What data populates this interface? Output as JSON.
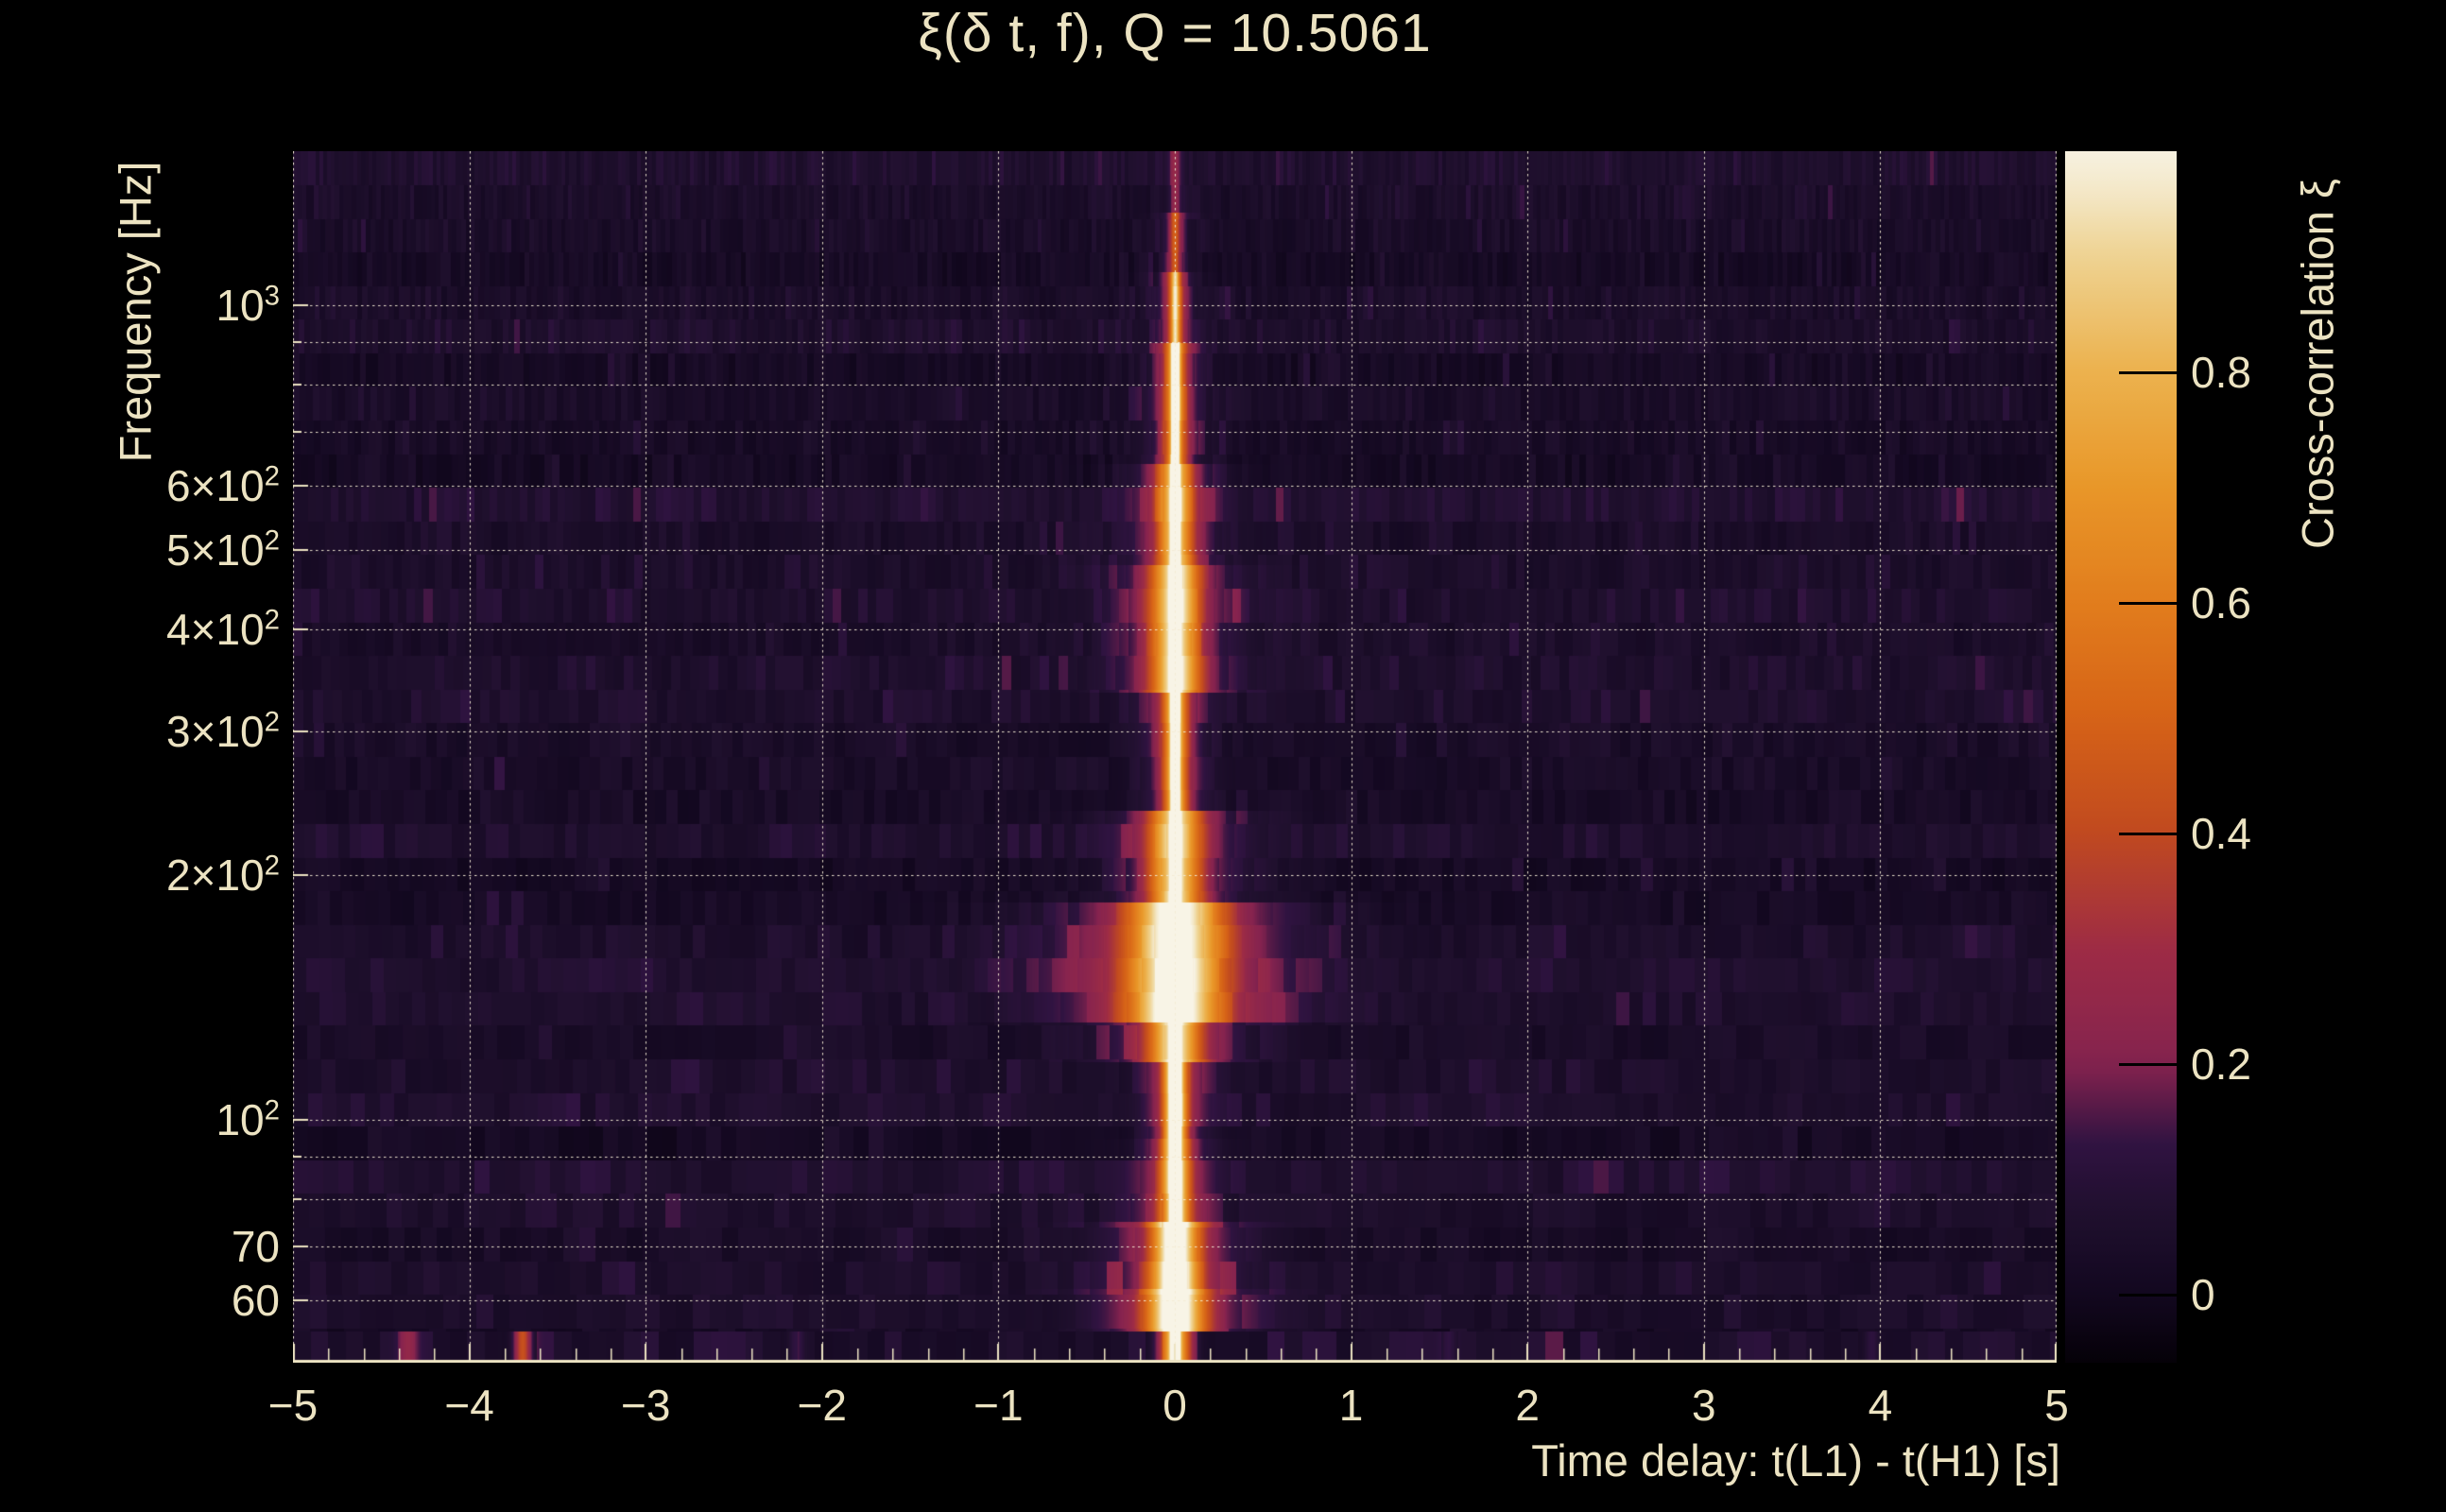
{
  "chart_data": {
    "type": "heatmap",
    "title": "ξ(δ t, f), Q = 10.5061",
    "xlabel": "Time delay: t(L1) - t(H1) [s]",
    "ylabel": "Frequency [Hz]",
    "colorbar_label": "Cross-correlation ξ",
    "background_color": "#000000",
    "text_color": "#ece3c2",
    "grid_color": "#f0e7ca",
    "x_range": [
      -5,
      5
    ],
    "x_major_ticks": [
      {
        "v": -5,
        "label": "−5"
      },
      {
        "v": -4,
        "label": "−4"
      },
      {
        "v": -3,
        "label": "−3"
      },
      {
        "v": -2,
        "label": "−2"
      },
      {
        "v": -1,
        "label": "−1"
      },
      {
        "v": 0,
        "label": "0"
      },
      {
        "v": 1,
        "label": "1"
      },
      {
        "v": 2,
        "label": "2"
      },
      {
        "v": 3,
        "label": "3"
      },
      {
        "v": 4,
        "label": "4"
      },
      {
        "v": 5,
        "label": "5"
      }
    ],
    "x_minor_tick_step": 0.2,
    "y_scale": "log",
    "y_range_hz": [
      50.5,
      1546
    ],
    "y_gridline_freqs_hz": [
      60,
      70,
      80,
      90,
      100,
      200,
      300,
      400,
      500,
      600,
      700,
      800,
      900,
      1000
    ],
    "y_tick_labels": [
      {
        "f": 1000,
        "text": "10",
        "sup": "3"
      },
      {
        "f": 600,
        "text": "6×10",
        "sup": "2"
      },
      {
        "f": 500,
        "text": "5×10",
        "sup": "2"
      },
      {
        "f": 400,
        "text": "4×10",
        "sup": "2"
      },
      {
        "f": 300,
        "text": "3×10",
        "sup": "2"
      },
      {
        "f": 200,
        "text": "2×10",
        "sup": "2"
      },
      {
        "f": 100,
        "text": "10",
        "sup": "2"
      },
      {
        "f": 70,
        "text": "70"
      },
      {
        "f": 60,
        "text": "60"
      }
    ],
    "colorbar": {
      "range": [
        -0.059,
        0.992
      ],
      "ticks": [
        {
          "v": 0.8,
          "label": "0.8"
        },
        {
          "v": 0.6,
          "label": "0.6"
        },
        {
          "v": 0.4,
          "label": "0.4"
        },
        {
          "v": 0.2,
          "label": "0.2"
        },
        {
          "v": 0.0,
          "label": "0"
        }
      ],
      "colormap_stops": [
        {
          "v": -0.06,
          "color": "#050108"
        },
        {
          "v": 0.0,
          "color": "#130820"
        },
        {
          "v": 0.07,
          "color": "#20102e"
        },
        {
          "v": 0.13,
          "color": "#301341"
        },
        {
          "v": 0.2,
          "color": "#85234f"
        },
        {
          "v": 0.3,
          "color": "#9e2c45"
        },
        {
          "v": 0.4,
          "color": "#c14a20"
        },
        {
          "v": 0.5,
          "color": "#d66317"
        },
        {
          "v": 0.6,
          "color": "#e27d1d"
        },
        {
          "v": 0.7,
          "color": "#e99729"
        },
        {
          "v": 0.8,
          "color": "#ecb24e"
        },
        {
          "v": 0.9,
          "color": "#efd391"
        },
        {
          "v": 0.96,
          "color": "#f4e9cb"
        },
        {
          "v": 1.0,
          "color": "#f8f4e6"
        }
      ]
    },
    "signal": {
      "ridge_delay_s": 0,
      "core_width_s": 0.016,
      "bands": [
        {
          "f_lo": 55,
          "f_hi": 62,
          "amp": 0.95,
          "half_width_s": 0.11,
          "core_amp": 1.0
        },
        {
          "f_lo": 62,
          "f_hi": 75,
          "amp": 0.95,
          "half_width_s": 0.09,
          "core_amp": 1.0
        },
        {
          "f_lo": 75,
          "f_hi": 95,
          "amp": 0.82,
          "half_width_s": 0.055,
          "core_amp": 1.0
        },
        {
          "f_lo": 95,
          "f_hi": 118,
          "amp": 0.9,
          "half_width_s": 0.045,
          "core_amp": 1.0
        },
        {
          "f_lo": 118,
          "f_hi": 132,
          "amp": 0.78,
          "half_width_s": 0.1,
          "core_amp": 0.9
        },
        {
          "f_lo": 132,
          "f_hi": 185,
          "amp": 0.88,
          "half_width_s": 0.18,
          "core_amp": 0.95
        },
        {
          "f_lo": 185,
          "f_hi": 240,
          "amp": 0.75,
          "half_width_s": 0.1,
          "core_amp": 0.9
        },
        {
          "f_lo": 240,
          "f_hi": 335,
          "amp": 0.68,
          "half_width_s": 0.05,
          "core_amp": 0.85
        },
        {
          "f_lo": 335,
          "f_hi": 480,
          "amp": 0.78,
          "half_width_s": 0.09,
          "core_amp": 0.9
        },
        {
          "f_lo": 480,
          "f_hi": 640,
          "amp": 0.7,
          "half_width_s": 0.07,
          "core_amp": 0.85
        },
        {
          "f_lo": 640,
          "f_hi": 900,
          "amp": 0.55,
          "half_width_s": 0.05,
          "core_amp": 0.8
        },
        {
          "f_lo": 900,
          "f_hi": 1100,
          "amp": 0.38,
          "half_width_s": 0.04,
          "core_amp": 0.45
        },
        {
          "f_lo": 1100,
          "f_hi": 1300,
          "amp": 0.22,
          "half_width_s": 0.035,
          "core_amp": 0.2
        },
        {
          "f_lo": 1300,
          "f_hi": 1546,
          "amp": 0.1,
          "half_width_s": 0.03,
          "core_amp": 0.08
        }
      ],
      "bottom_noise_row_hz": [
        50.5,
        55
      ],
      "bottom_row_features": [
        {
          "delay_s": -3.7,
          "amp": 0.4,
          "width_s": 0.035
        },
        {
          "delay_s": -4.35,
          "amp": 0.14,
          "width_s": 0.04
        },
        {
          "delay_s": -2.15,
          "amp": 0.1,
          "width_s": 0.03
        },
        {
          "delay_s": 1.55,
          "amp": 0.08,
          "width_s": 0.03
        },
        {
          "delay_s": 3.95,
          "amp": 0.09,
          "width_s": 0.03
        }
      ],
      "noise_floor_range": [
        0.02,
        0.12
      ]
    }
  }
}
